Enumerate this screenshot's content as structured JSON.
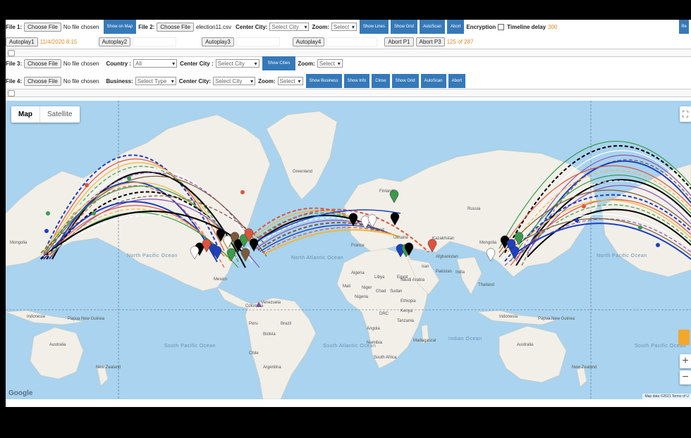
{
  "row1": {
    "file1_label": "File 1:",
    "choose_file": "Choose File",
    "no_file": "No file chosen",
    "show_on_map": "Show on Map",
    "file2_label": "File 2:",
    "file2_name": "election11.csv",
    "center_city_label": "Center City:",
    "select_city": "Select City",
    "zoom_label": "Zoom:",
    "select": "Select",
    "show_lines": "Show Lines",
    "show_grid": "Show Grid",
    "autoscan": "AutoScan",
    "abort": "Abort",
    "encryption_label": "Encryption",
    "timeline_label": "Timeline delay",
    "timeline_value": "300",
    "right_cut": "Re"
  },
  "row2": {
    "autoplay1": "Autoplay1",
    "date": "11/4/2020 8:15",
    "autoplay2": "Autoplay2",
    "autoplay3": "Autoplay3",
    "autoplay4": "Autoplay4",
    "abort_p1": "Abort P1",
    "abort_p3": "Abort P3",
    "progress": "125 of 287"
  },
  "row3": {
    "file3_label": "File 3:",
    "choose_file": "Choose File",
    "no_file": "No file chosen",
    "country_label": "Country :",
    "country_value": "All",
    "center_city_label": "Center City :",
    "select_city": "Select City",
    "show_cities": "Show Cities",
    "zoom_label": "Zoom:",
    "select": "Select"
  },
  "row4": {
    "file4_label": "File 4:",
    "choose_file": "Choose File",
    "no_file": "No file chosen",
    "business_label": "Business:",
    "select_type": "Select Type",
    "center_city_label": "Center City:",
    "select_city": "Select City",
    "zoom_label": "Zoom:",
    "select": "Select",
    "show_business": "Show Business",
    "show_info": "Show Info",
    "close": "Close",
    "show_grid": "Show Grid",
    "autoscan": "AutoScan",
    "abort": "Abort"
  },
  "map": {
    "tab_map": "Map",
    "tab_satellite": "Satellite",
    "google": "Google",
    "attribution": "Map data ©2021   Terms of U",
    "zoom_in": "+",
    "zoom_out": "−",
    "fullscreen": "⛶",
    "labels": {
      "greenland": "Greenland",
      "finland": "Finland",
      "russia": "Russia",
      "poland": "Poland",
      "ukraine": "Ukraine",
      "france": "France",
      "kazakhstan": "Kazakhstan",
      "mongolia_l": "Mongolia",
      "mongolia_r": "Mongolia",
      "iran": "Iran",
      "afghanistan": "Afghanistan",
      "pakistan": "Pakistan",
      "algeria": "Algeria",
      "libya": "Libya",
      "egypt": "Egypt",
      "saudi": "Saudi Arabia",
      "mali": "Mali",
      "niger": "Niger",
      "chad": "Chad",
      "sudan": "Sudan",
      "nigeria": "Nigeria",
      "ethiopia": "Ethiopia",
      "drc": "DRC",
      "kenya": "Kenya",
      "tanzania": "Tanzania",
      "angola": "Angola",
      "namibia": "Namibia",
      "south_africa": "South Africa",
      "madagascar": "Madagascar",
      "mexico": "Mexico",
      "venezuela": "Venezuela",
      "colombia": "Colombia",
      "peru": "Peru",
      "brazil": "Brazil",
      "bolivia": "Bolivia",
      "chile": "Chile",
      "argentina": "Argentina",
      "thailand": "Thailand",
      "indonesia_l": "Indonesia",
      "indonesia_r": "Indonesia",
      "png_l": "Papua New Guinea",
      "png_r": "Papua New Guinea",
      "australia_l": "Australia",
      "australia_r": "Australia",
      "nz_l": "New Zealand",
      "nz_r": "New Zealand",
      "india": "India"
    },
    "oceans": {
      "npac_l": "North Pacific Ocean",
      "natl": "North Atlantic Ocean",
      "npac_r": "North Pacific Ocean",
      "spac_l": "South Pacific Ocean",
      "satl": "South Atlantic Ocean",
      "indian": "Indian Ocean",
      "spac_r": "South Pacific Ocean"
    }
  },
  "colors": {
    "button_blue": "#3679b8",
    "land": "#f1efe8",
    "water": "#a9d3ee",
    "accent_orange": "#e08a2a",
    "arc_colors": [
      "#1f3fbf",
      "#e0533a",
      "#f2b63c",
      "#3b9a4b",
      "#000000",
      "#ffffff",
      "#8a55b8",
      "#7a5a3a"
    ]
  }
}
